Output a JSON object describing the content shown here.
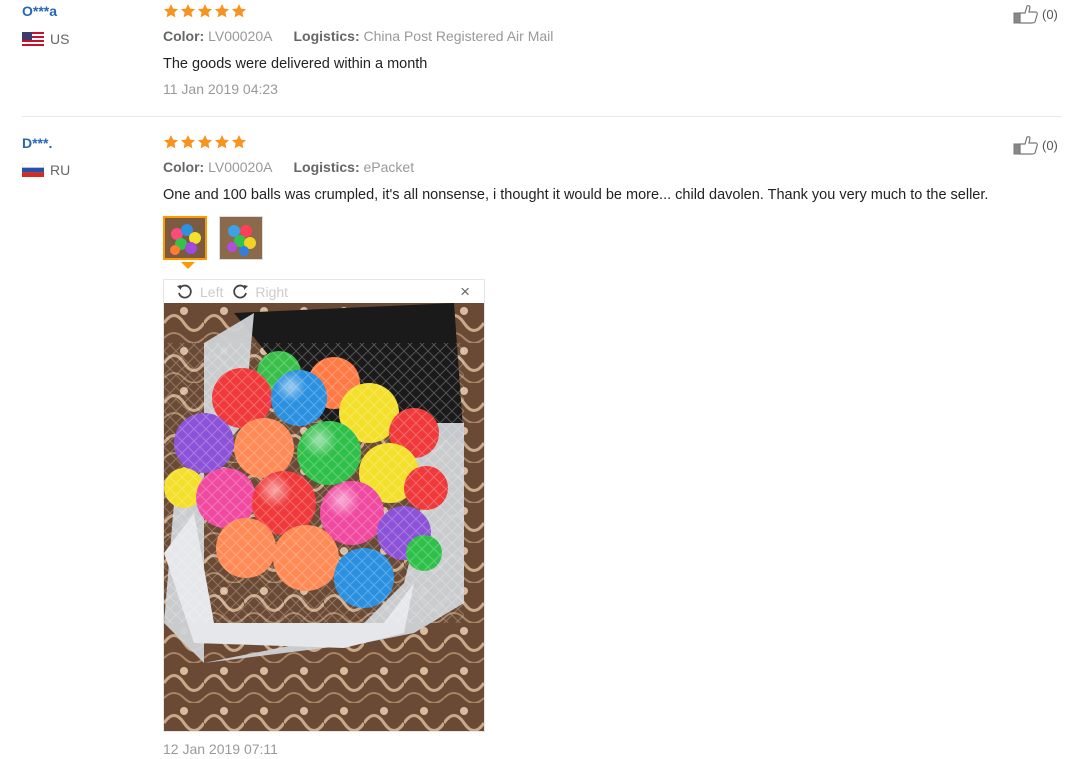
{
  "reviews": [
    {
      "user": "O***a",
      "country": "US",
      "color_label": "Color:",
      "color_value": "LV00020A",
      "logistics_label": "Logistics:",
      "logistics_value": "China Post Registered Air Mail",
      "text": "The goods were delivered within a month",
      "date": "11 Jan 2019 04:23",
      "likes": "(0)",
      "rating": 5
    },
    {
      "user": "D***.",
      "country": "RU",
      "color_label": "Color:",
      "color_value": "LV00020A",
      "logistics_label": "Logistics:",
      "logistics_value": "ePacket",
      "text": "One and 100 balls was crumpled, it's all nonsense, i thought it would be more... child davolen. Thank you very much to the seller.",
      "date": "12 Jan 2019 07:11",
      "likes": "(0)",
      "rating": 5
    }
  ],
  "viewer": {
    "rotate_left": "Left",
    "rotate_right": "Right",
    "close": "×"
  },
  "colors": {
    "star": "#f7931e",
    "user": "#2766b6",
    "active_thumb": "#ff9900"
  },
  "icons": [
    "star-icon",
    "thumbs-up-icon",
    "flag-us-icon",
    "flag-ru-icon",
    "rotate-left-icon",
    "rotate-right-icon",
    "close-icon"
  ]
}
